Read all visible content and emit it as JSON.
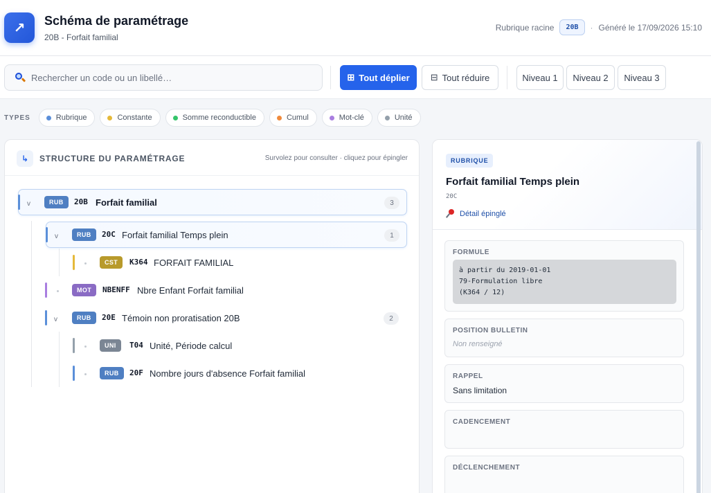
{
  "header": {
    "logo_glyph": "↗",
    "title": "Schéma de paramétrage",
    "subtitle": "20B - Forfait familial",
    "root_label": "Rubrique racine",
    "root_code": "20B",
    "separator": "·",
    "generated": "Généré le 17/09/2026 15:10"
  },
  "toolbar": {
    "search_placeholder": "Rechercher un code ou un libellé…",
    "expand_icon": "⊞",
    "expand_label": "Tout déplier",
    "collapse_icon": "⊟",
    "collapse_label": "Tout réduire",
    "level_buttons": [
      "Niveau 1",
      "Niveau 2",
      "Niveau 3"
    ]
  },
  "types": {
    "label": "TYPES",
    "items": [
      {
        "label": "Rubrique",
        "color": "#5b8fd9"
      },
      {
        "label": "Constante",
        "color": "#e5b93a"
      },
      {
        "label": "Somme reconductible",
        "color": "#34c46a"
      },
      {
        "label": "Cumul",
        "color": "#f08a3c"
      },
      {
        "label": "Mot-clé",
        "color": "#a97ee0"
      },
      {
        "label": "Unité",
        "color": "#94a0ab"
      }
    ]
  },
  "tree_panel": {
    "icon_glyph": "↳",
    "title": "STRUCTURE DU PARAMÉTRAGE",
    "hint": "Survolez pour consulter · cliquez pour épingler",
    "chevron": "v",
    "nodes": [
      {
        "tag": "RUB",
        "code": "20B",
        "label": "Forfait familial",
        "count": "3",
        "tag_color": "#4f7fc2",
        "bar_color": "#5b8fd9"
      },
      {
        "tag": "RUB",
        "code": "20C",
        "label": "Forfait familial Temps plein",
        "count": "1",
        "tag_color": "#4f7fc2",
        "bar_color": "#5b8fd9"
      },
      {
        "tag": "CST",
        "code": "K364",
        "label": "FORFAIT FAMILIAL",
        "tag_color": "#b89a2b",
        "bar_color": "#e5b93a"
      },
      {
        "tag": "MOT",
        "code": "NBENFF",
        "label": "Nbre Enfant Forfait familial",
        "tag_color": "#8a6bc4",
        "bar_color": "#a97ee0"
      },
      {
        "tag": "RUB",
        "code": "20E",
        "label": "Témoin non proratisation 20B",
        "count": "2",
        "tag_color": "#4f7fc2",
        "bar_color": "#5b8fd9"
      },
      {
        "tag": "UNI",
        "code": "T04",
        "label": "Unité, Période calcul",
        "tag_color": "#7b8694",
        "bar_color": "#94a0ab"
      },
      {
        "tag": "RUB",
        "code": "20F",
        "label": "Nombre jours d'absence Forfait familial",
        "tag_color": "#4f7fc2",
        "bar_color": "#5b8fd9"
      }
    ]
  },
  "detail": {
    "type": "RUBRIQUE",
    "title": "Forfait familial Temps plein",
    "code": "20C",
    "pinned": "Détail épinglé",
    "sections": {
      "formule_title": "FORMULE",
      "formule_lines": "à partir du 2019-01-01\n79-Formulation libre\n(K364 / 12)",
      "position_title": "POSITION BULLETIN",
      "position_value": "Non renseigné",
      "rappel_title": "RAPPEL",
      "rappel_value": "Sans limitation",
      "cadencement_title": "CADENCEMENT",
      "declenchement_title": "DÉCLENCHEMENT"
    }
  }
}
